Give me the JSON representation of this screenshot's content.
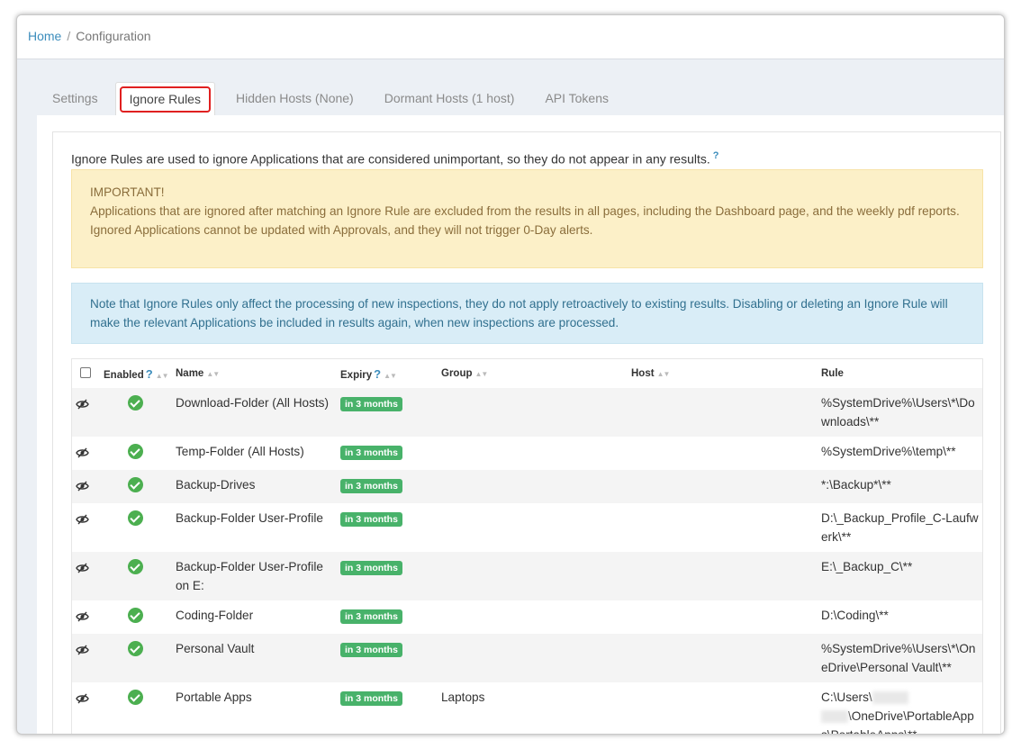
{
  "breadcrumb": {
    "home": "Home",
    "separator": "/",
    "current": "Configuration"
  },
  "tabs": [
    {
      "label": "Settings"
    },
    {
      "label": "Ignore Rules"
    },
    {
      "label": "Hidden Hosts (None)"
    },
    {
      "label": "Dormant Hosts (1 host)"
    },
    {
      "label": "API Tokens"
    }
  ],
  "intro": {
    "text": "Ignore Rules are used to ignore Applications that are considered unimportant, so they do not appear in any results.",
    "help": "?"
  },
  "warning": {
    "title": "IMPORTANT!",
    "line1": "Applications that are ignored after matching an Ignore Rule are excluded from the results in all pages, including the Dashboard page, and the weekly pdf reports.",
    "line2": "Ignored Applications cannot be updated with Approvals, and they will not trigger 0-Day alerts."
  },
  "info": {
    "text": "Note that Ignore Rules only affect the processing of new inspections, they do not apply retroactively to existing results. Disabling or deleting an Ignore Rule will make the relevant Applications be included in results again, when new inspections are processed."
  },
  "table": {
    "headers": {
      "enabled": "Enabled",
      "name": "Name",
      "expiry": "Expiry",
      "group": "Group",
      "host": "Host",
      "rule": "Rule",
      "help": "?"
    },
    "rows": [
      {
        "name": "Download-Folder (All Hosts)",
        "expiry": "in 3 months",
        "group": "",
        "host": "",
        "rule": "%SystemDrive%\\Users\\*\\Downloads\\**"
      },
      {
        "name": "Temp-Folder (All Hosts)",
        "expiry": "in 3 months",
        "group": "",
        "host": "",
        "rule": "%SystemDrive%\\temp\\**"
      },
      {
        "name": "Backup-Drives",
        "expiry": "in 3 months",
        "group": "",
        "host": "",
        "rule": "*:\\Backup*\\**"
      },
      {
        "name": "Backup-Folder User-Profile",
        "expiry": "in 3 months",
        "group": "",
        "host": "",
        "rule": "D:\\_Backup_Profile_C-Laufwerk\\**"
      },
      {
        "name": "Backup-Folder User-Profile on E:",
        "expiry": "in 3 months",
        "group": "",
        "host": "",
        "rule": "E:\\_Backup_C\\**"
      },
      {
        "name": "Coding-Folder",
        "expiry": "in 3 months",
        "group": "",
        "host": "",
        "rule": "D:\\Coding\\**"
      },
      {
        "name": "Personal Vault",
        "expiry": "in 3 months",
        "group": "",
        "host": "",
        "rule": "%SystemDrive%\\Users\\*\\OneDrive\\Personal Vault\\**"
      },
      {
        "name": "Portable Apps",
        "expiry": "in 3 months",
        "group": "Laptops",
        "host": "",
        "rule_prefix": "C:\\Users\\",
        "rule_suffix": "\\OneDrive\\PortableApps\\PortableApps\\**"
      }
    ]
  },
  "colors": {
    "accent": "#3c8dbc",
    "success": "#48b26a",
    "highlight": "#e02020"
  }
}
